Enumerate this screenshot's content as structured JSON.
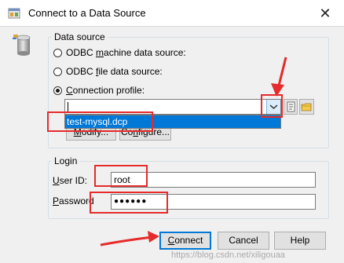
{
  "window": {
    "title": "Connect to a Data Source",
    "close_glyph": "✕"
  },
  "data_source": {
    "legend": "Data source",
    "options": [
      {
        "label": "ODBC machine data source:",
        "selected": false
      },
      {
        "label": "ODBC file data source:",
        "selected": false
      },
      {
        "label": "Connection profile:",
        "selected": true
      }
    ],
    "profile_value": "",
    "dropdown_items": [
      "test-mysql.dcp"
    ],
    "modify_label": "Modify...",
    "configure_label": "Configure..."
  },
  "login": {
    "legend": "Login",
    "user_id_label": "User ID:",
    "user_id_value": "root",
    "password_label": "Password",
    "password_value": "●●●●●●"
  },
  "buttons": {
    "connect": "Connect",
    "cancel": "Cancel",
    "help": "Help"
  },
  "watermark": "https://blog.csdn.net/xiligouaa",
  "colors": {
    "annotation_red": "#e52b2b",
    "selection_blue": "#0078d7"
  },
  "icons": [
    "app-icon",
    "database-icon",
    "close-icon",
    "chevron-down-icon",
    "properties-icon",
    "folder-icon"
  ]
}
